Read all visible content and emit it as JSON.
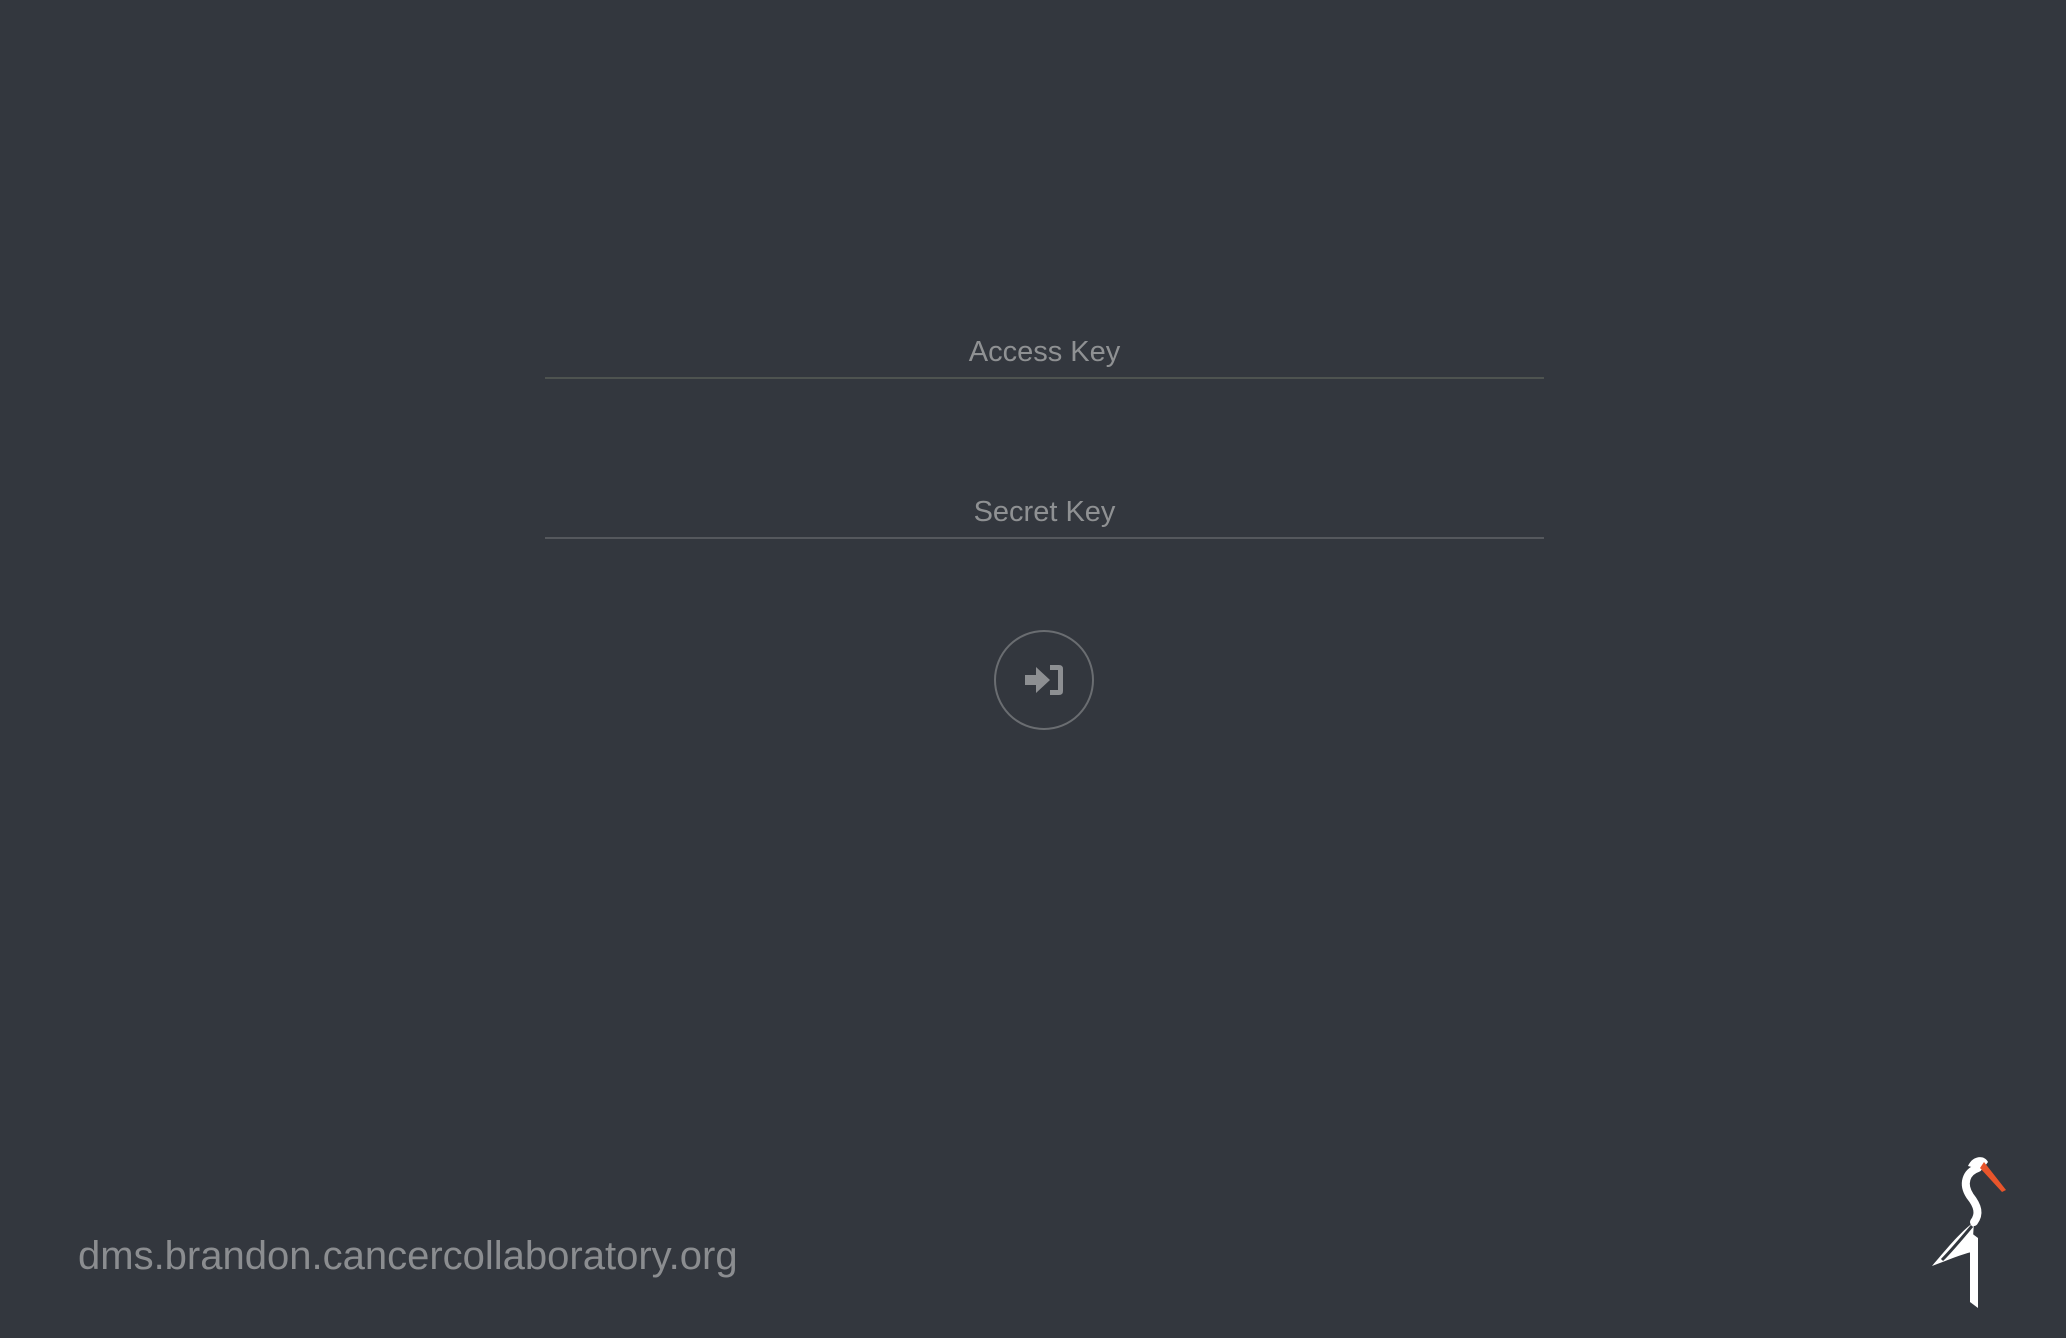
{
  "login": {
    "access_key": {
      "placeholder": "Access Key",
      "value": ""
    },
    "secret_key": {
      "placeholder": "Secret Key",
      "value": ""
    },
    "submit_icon": "sign-in-icon"
  },
  "footer": {
    "host": "dms.brandon.cancercollaboratory.org",
    "logo_icon": "minio-crane-logo-icon"
  },
  "colors": {
    "background": "#33373e",
    "text": "#8f9193",
    "logo_accent": "#e8552b",
    "logo_body": "#ffffff"
  }
}
